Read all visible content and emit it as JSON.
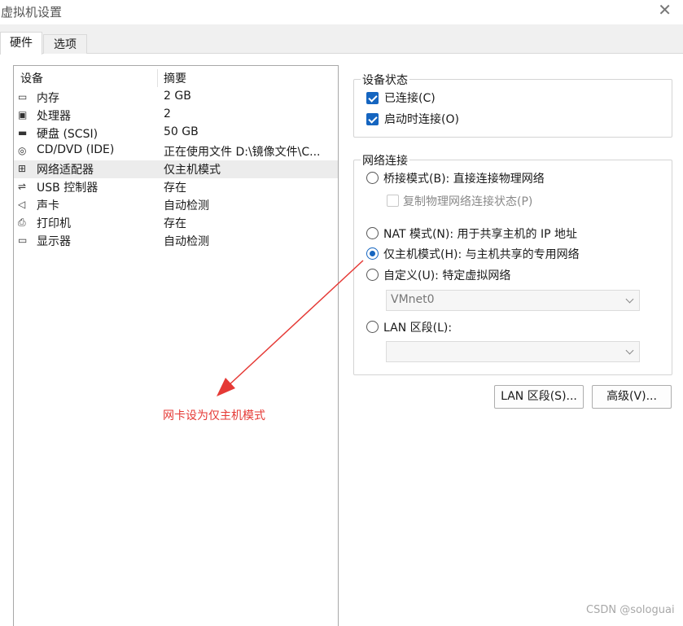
{
  "window": {
    "title": "虚拟机设置",
    "close_glyph": "✕"
  },
  "tabs": [
    {
      "label": "硬件",
      "active": true
    },
    {
      "label": "选项",
      "active": false
    }
  ],
  "device_list": {
    "headers": {
      "device": "设备",
      "summary": "摘要"
    },
    "rows": [
      {
        "name": "内存",
        "summary": "2 GB",
        "icon": "memory-icon",
        "glyph": "▭",
        "selected": false
      },
      {
        "name": "处理器",
        "summary": "2",
        "icon": "cpu-icon",
        "glyph": "▣",
        "selected": false
      },
      {
        "name": "硬盘 (SCSI)",
        "summary": "50 GB",
        "icon": "hard-disk-icon",
        "glyph": "▬",
        "selected": false
      },
      {
        "name": "CD/DVD (IDE)",
        "summary": "正在使用文件 D:\\镜像文件\\C...",
        "icon": "cd-dvd-icon",
        "glyph": "◎",
        "selected": false
      },
      {
        "name": "网络适配器",
        "summary": "仅主机模式",
        "icon": "network-adapter-icon",
        "glyph": "⊞",
        "selected": true
      },
      {
        "name": "USB 控制器",
        "summary": "存在",
        "icon": "usb-icon",
        "glyph": "⇌",
        "selected": false
      },
      {
        "name": "声卡",
        "summary": "自动检测",
        "icon": "speaker-icon",
        "glyph": "◁",
        "selected": false
      },
      {
        "name": "打印机",
        "summary": "存在",
        "icon": "printer-icon",
        "glyph": "⎙",
        "selected": false
      },
      {
        "name": "显示器",
        "summary": "自动检测",
        "icon": "monitor-icon",
        "glyph": "▭",
        "selected": false
      }
    ]
  },
  "device_status": {
    "legend": "设备状态",
    "connected": {
      "label": "已连接(C)",
      "checked": true
    },
    "connect_on_power": {
      "label": "启动时连接(O)",
      "checked": true
    }
  },
  "network": {
    "legend": "网络连接",
    "bridged": {
      "label": "桥接模式(B): 直接连接物理网络",
      "selected": false
    },
    "replicate": {
      "label": "复制物理网络连接状态(P)",
      "checked": false,
      "enabled": false
    },
    "nat": {
      "label": "NAT 模式(N): 用于共享主机的 IP 地址",
      "selected": false
    },
    "host_only": {
      "label": "仅主机模式(H): 与主机共享的专用网络",
      "selected": true
    },
    "custom": {
      "label": "自定义(U): 特定虚拟网络",
      "selected": false
    },
    "custom_select": {
      "value": "VMnet0",
      "enabled": false
    },
    "lan_segment": {
      "label": "LAN 区段(L):",
      "selected": false
    },
    "lan_select": {
      "value": "",
      "enabled": false
    }
  },
  "buttons": {
    "lan_segments": "LAN 区段(S)...",
    "advanced": "高级(V)..."
  },
  "annotation": {
    "text": "网卡设为仅主机模式",
    "color": "#e53935"
  },
  "watermark": "CSDN @sologuai",
  "colors": {
    "accent": "#1565c0",
    "selection": "#ececec"
  }
}
